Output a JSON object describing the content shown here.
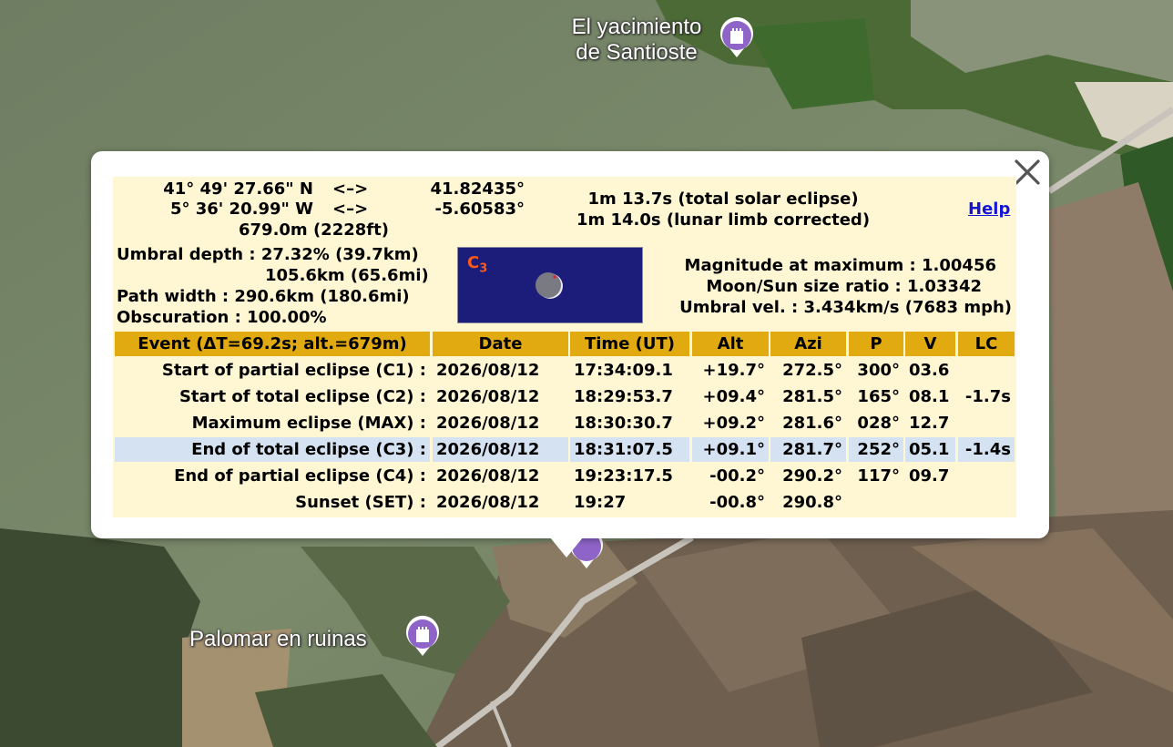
{
  "map": {
    "places": [
      {
        "name_line1": "El yacimiento",
        "name_line2": "de Santioste"
      },
      {
        "name": "Palomar en ruinas"
      }
    ],
    "marker_color": "#8f64c8"
  },
  "popup": {
    "close_icon": "close-icon",
    "coords": {
      "lat_dms": "41° 49' 27.66\" N",
      "lon_dms": "5° 36' 20.99\" W",
      "arrow": "<–>",
      "lat_dec": "41.82435°",
      "lon_dec": "-5.60583°",
      "elevation": "679.0m (2228ft)"
    },
    "duration": {
      "total": "1m 13.7s (total solar eclipse)",
      "limb": "1m 14.0s (lunar limb corrected)"
    },
    "help_label": "Help",
    "umbral": {
      "depth": "Umbral depth : 27.32% (39.7km)",
      "depth_2": "105.6km (65.6mi)",
      "path_width": "Path width : 290.6km (180.6mi)",
      "obscuration": "Obscuration : 100.00%"
    },
    "image": {
      "contact_letter": "C",
      "contact_sub": "3",
      "sky_color": "#1c1c7a",
      "label_color": "#ff5a1a"
    },
    "stats": {
      "magnitude": "Magnitude at maximum : 1.00456",
      "ratio": "Moon/Sun size ratio : 1.03342",
      "velocity": "Umbral vel. : 3.434km/s (7683 mph)"
    },
    "table": {
      "headers": [
        "Event (ΔT=69.2s; alt.=679m)",
        "Date",
        "Time (UT)",
        "Alt",
        "Azi",
        "P",
        "V",
        "LC"
      ],
      "rows": [
        [
          "Start of partial eclipse (C1) :",
          "2026/08/12",
          "17:34:09.1",
          "+19.7°",
          "272.5°",
          "300°",
          "03.6",
          ""
        ],
        [
          "Start of total eclipse (C2) :",
          "2026/08/12",
          "18:29:53.7",
          "+09.4°",
          "281.5°",
          "165°",
          "08.1",
          "-1.7s"
        ],
        [
          "Maximum eclipse (MAX) :",
          "2026/08/12",
          "18:30:30.7",
          "+09.2°",
          "281.6°",
          "028°",
          "12.7",
          ""
        ],
        [
          "End of total eclipse (C3) :",
          "2026/08/12",
          "18:31:07.5",
          "+09.1°",
          "281.7°",
          "252°",
          "05.1",
          "-1.4s"
        ],
        [
          "End of partial eclipse (C4) :",
          "2026/08/12",
          "19:23:17.5",
          "-00.2°",
          "290.2°",
          "117°",
          "09.7",
          ""
        ],
        [
          "Sunset (SET) :",
          "2026/08/12",
          "19:27",
          "-00.8°",
          "290.8°",
          "",
          "",
          ""
        ]
      ],
      "highlighted_row": 3,
      "header_color": "#e0aa10",
      "highlight_color": "#d4e2f2",
      "panel_color": "#fff6d4"
    }
  }
}
